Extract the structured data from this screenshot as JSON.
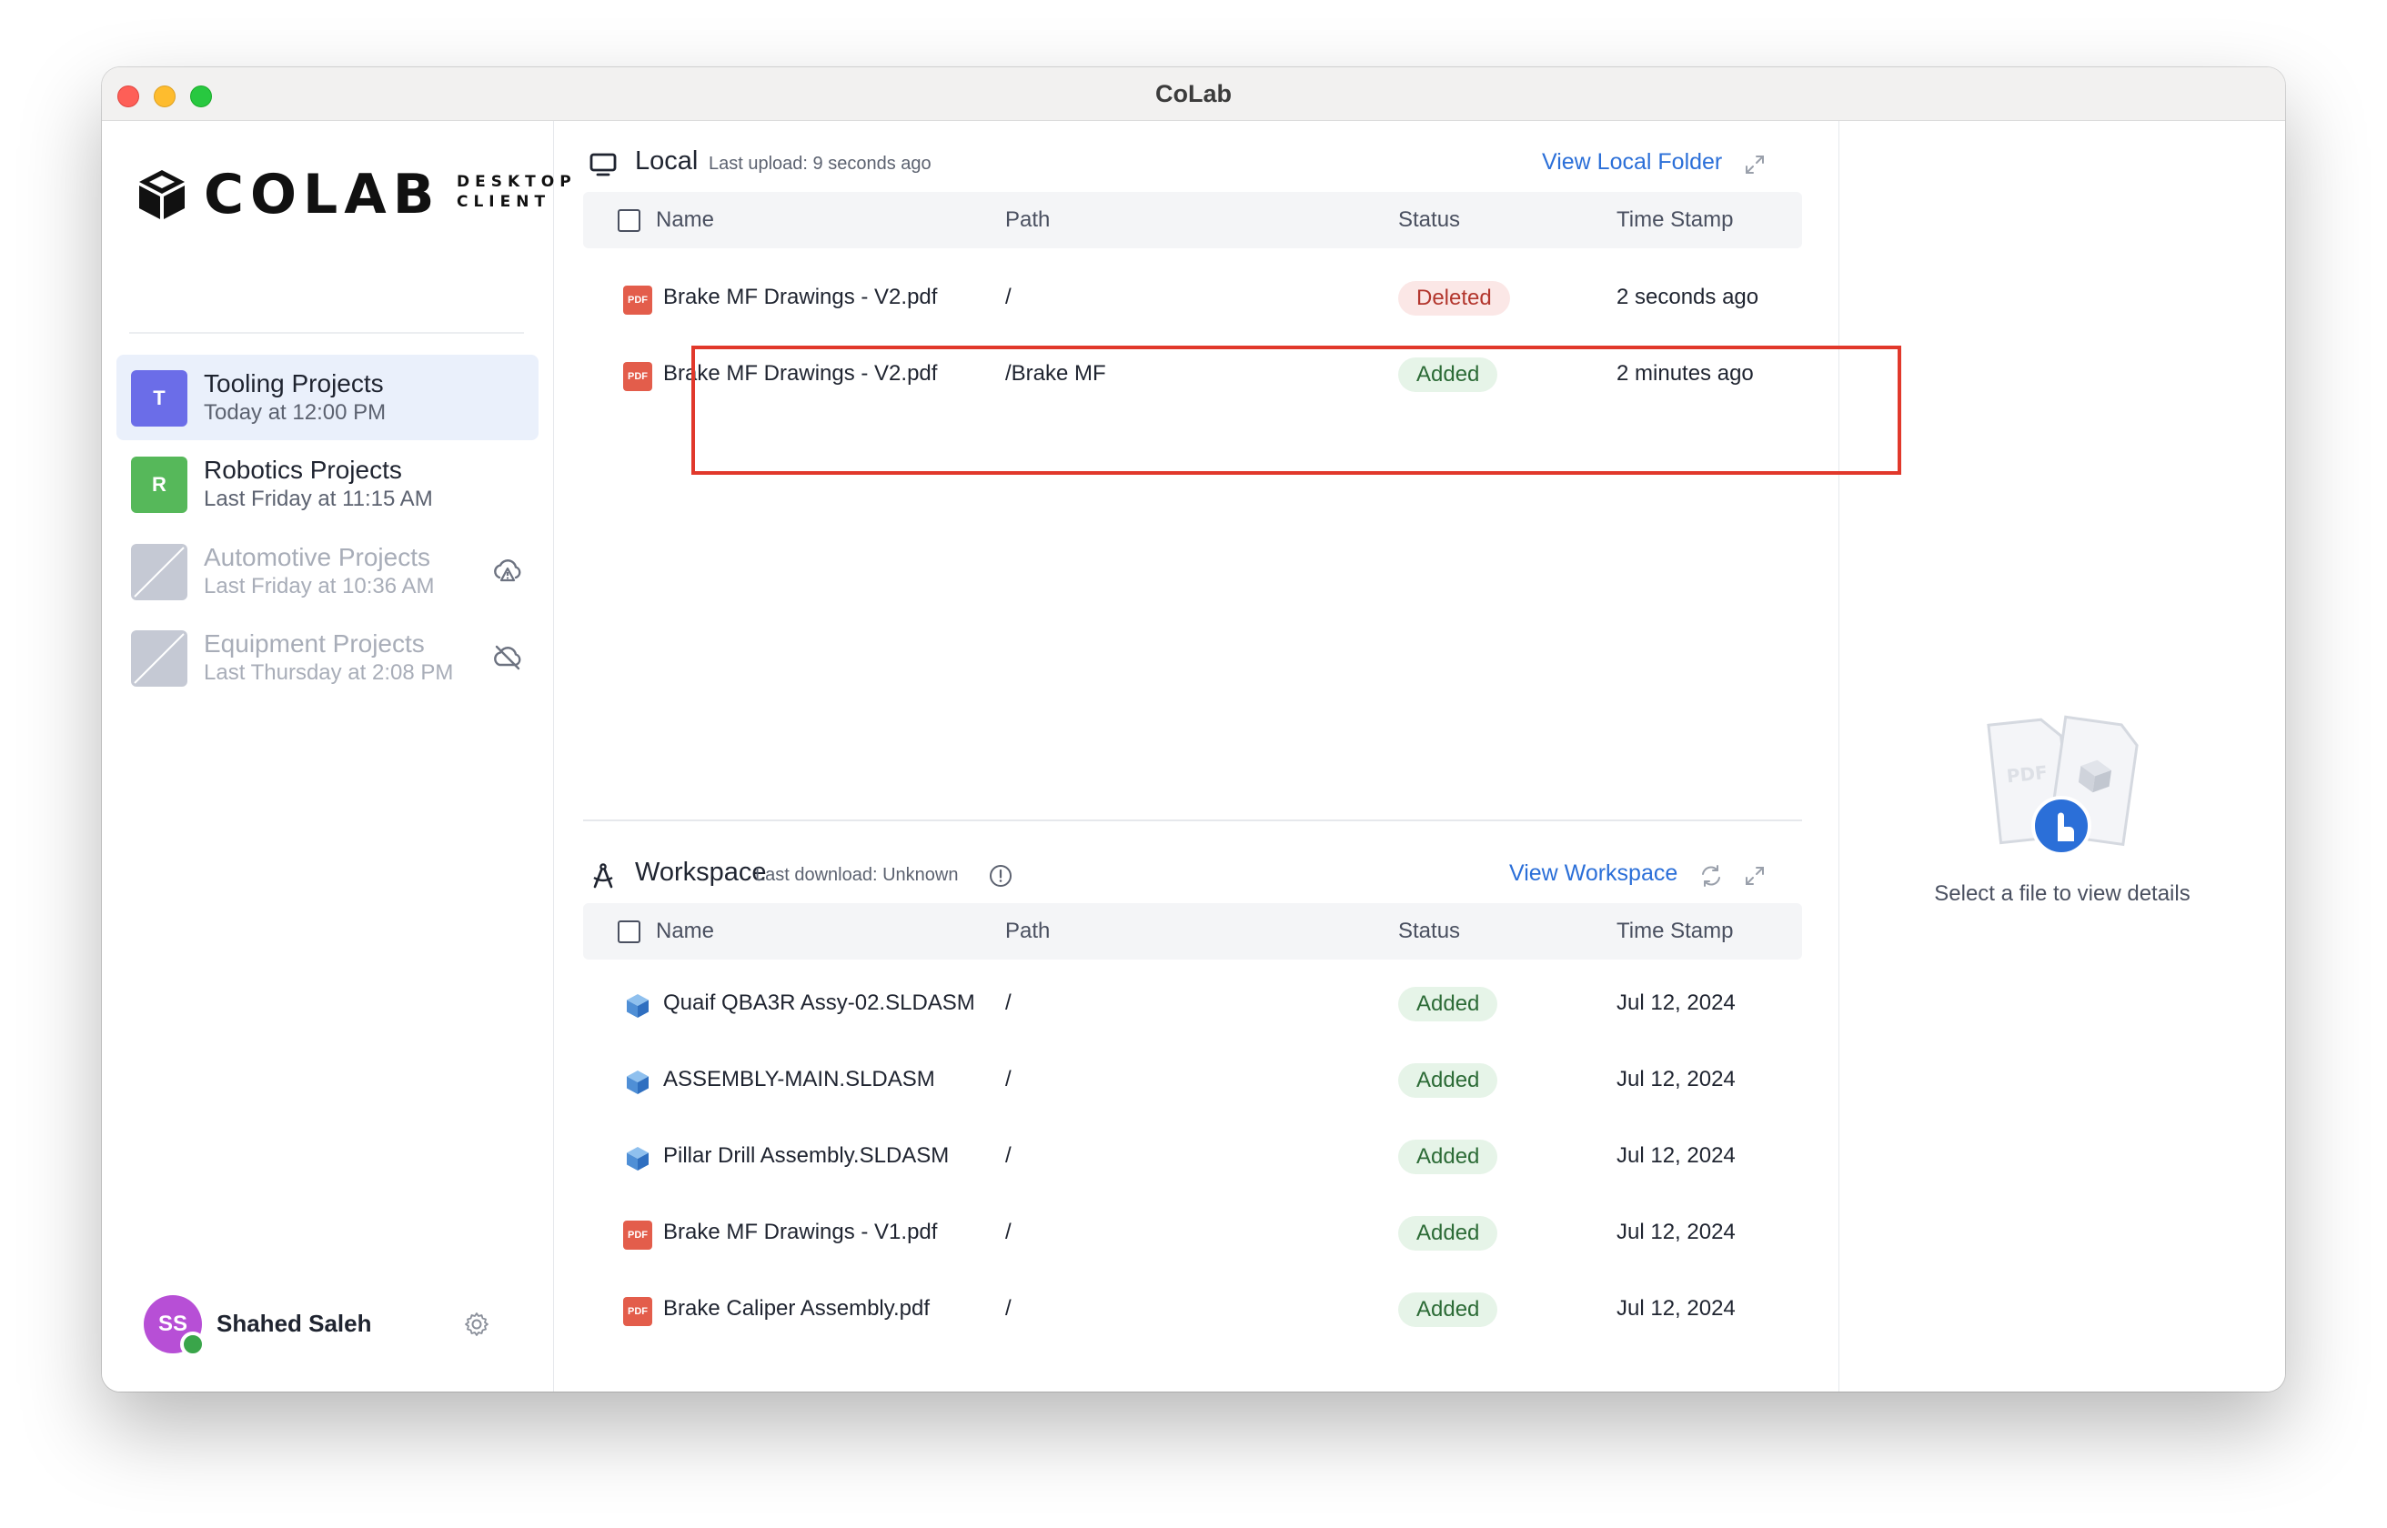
{
  "window": {
    "title": "CoLab"
  },
  "logo": {
    "wordmark": "COLAB",
    "sub_line1": "DESKTOP",
    "sub_line2": "CLIENT"
  },
  "projects": [
    {
      "initial": "T",
      "name": "Tooling Projects",
      "time": "Today at 12:00 PM",
      "color": "#6b6de8",
      "active": true
    },
    {
      "initial": "R",
      "name": "Robotics Projects",
      "time": "Last Friday at 11:15 AM",
      "color": "#56b85a",
      "active": false
    },
    {
      "initial": "",
      "name": "Automotive Projects",
      "time": "Last Friday at 10:36 AM",
      "status_icon": "cloud-upload-warning-icon",
      "dimmed": true
    },
    {
      "initial": "",
      "name": "Equipment Projects",
      "time": "Last Thursday at 2:08 PM",
      "status_icon": "cloud-off-icon",
      "dimmed": true
    }
  ],
  "user": {
    "initials": "SS",
    "name": "Shahed Saleh",
    "avatar_color": "#b74fd6",
    "status": "online"
  },
  "local": {
    "title": "Local",
    "subtitle": "Last upload: 9 seconds ago",
    "link": "View Local Folder",
    "columns": [
      "Name",
      "Path",
      "Status",
      "Time Stamp"
    ],
    "rows": [
      {
        "type": "pdf",
        "name": "Brake MF Drawings - V2.pdf",
        "path": "/",
        "status": "Deleted",
        "time": "2 seconds ago"
      },
      {
        "type": "pdf",
        "name": "Brake MF Drawings - V2.pdf",
        "path": "/Brake MF",
        "status": "Added",
        "time": "2 minutes ago"
      }
    ]
  },
  "workspace": {
    "title": "Workspace",
    "subtitle": "Last download: Unknown",
    "link": "View Workspace",
    "columns": [
      "Name",
      "Path",
      "Status",
      "Time Stamp"
    ],
    "rows": [
      {
        "type": "cad",
        "name": "Quaif QBA3R Assy-02.SLDASM",
        "path": "/",
        "status": "Added",
        "time": "Jul 12, 2024"
      },
      {
        "type": "cad",
        "name": "ASSEMBLY-MAIN.SLDASM",
        "path": "/",
        "status": "Added",
        "time": "Jul 12, 2024"
      },
      {
        "type": "cad",
        "name": "Pillar Drill Assembly.SLDASM",
        "path": "/",
        "status": "Added",
        "time": "Jul 12, 2024"
      },
      {
        "type": "pdf",
        "name": "Brake MF Drawings - V1.pdf",
        "path": "/",
        "status": "Added",
        "time": "Jul 12, 2024"
      },
      {
        "type": "pdf",
        "name": "Brake Caliper Assembly.pdf",
        "path": "/",
        "status": "Added",
        "time": "Jul 12, 2024"
      }
    ]
  },
  "details": {
    "empty_text": "Select a file to view details",
    "illustration_label": "PDF"
  },
  "icons": {
    "pdf_label": "PDF"
  },
  "colors": {
    "accent": "#2b6fd8",
    "highlight_border": "#e1382b",
    "added_bg": "#e6f4e8",
    "deleted_bg": "#fbe7e6"
  }
}
